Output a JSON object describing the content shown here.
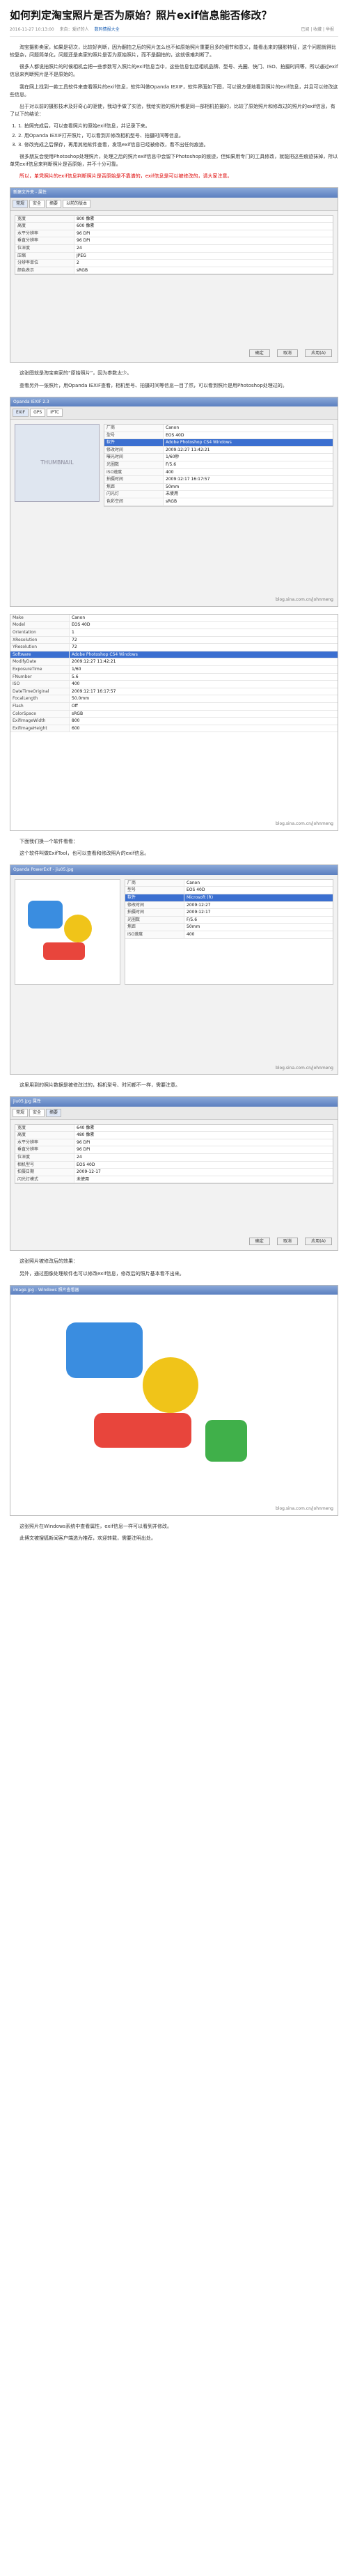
{
  "title": "如何判定淘宝照片是否为原始？照片exif信息能否修改？",
  "meta": {
    "date": "2016-11-27 10:13:00",
    "source": "来自：爱好的人",
    "category": "数码情报大全",
    "share": "已阅 | 收藏 | 举报"
  },
  "paras": [
    "淘宝摄影卖家，如果是初次，比较好判断，因为翻拍之后的照片怎么也不如原始照片重要且多的细节和意义，能看出来的摄影特征，这个问题就得比较复杂，问题简单化，问题还是卖家的照片是否为原始照片，而不是翻拍的，这就很难判断了。",
    "很多人都说拍照片的时候相机会把一些参数写入照片的exif信息当中，这些信息包括相机品牌、型号、光圈、快门、ISO、拍摄时间等，所以通过exif信息来判断照片是不是原始的。",
    "我在网上找到一款工具软件来查看照片的exif信息，软件叫做Opanda IEXIF，软件界面如下图，可以很方便地看到照片的exif信息，并且可以修改这些信息。",
    "出于对以前的摄影技术及好奇心的驱使，我动手做了实验，我给实验的照片都是同一部相机拍摄的，比较了原始照片和修改过的照片的exif信息，有了以下的结论：",
    "很多朋友会使用Photoshop处理照片，处理之后的照片exif信息中会留下Photoshop的痕迹，但如果用专门的工具修改，就能把这些痕迹抹掉，所以单凭exif信息来判断照片是否原始，并不十分可靠。"
  ],
  "list": [
    "1. 拍照完成后，可以查看照片的原始exif信息，并记录下来。",
    "2. 用Opanda IEXIF打开照片，可以看到并修改相机型号、拍摄时间等信息。",
    "3. 修改完成之后保存，再用其他软件查看，发现exif信息已经被修改，看不出任何痕迹。"
  ],
  "red_note": "所以，单凭照片的exif信息判断照片是否原始是不靠谱的，exif信息是可以被修改的，请大家注意。",
  "captions": {
    "c1": "这张图就是淘宝卖家的“原始照片”，因为参数太少。",
    "c2": "查看另外一张照片，用Opanda IEXIF查看，相机型号、拍摄时间等信息一目了然，可以看到照片是用Photoshop处理过的。",
    "c3": "下面我们换一个软件看看：",
    "c4": "这个软件叫做ExifTool，也可以查看和修改照片的exif信息。",
    "c5": "这里用到的照片数据是被修改过的，相机型号、时间都不一样，需要注意。",
    "c6": "这张照片被修改后的效果：",
    "c7": "另外，通过图像处理软件也可以修改exif信息，修改后的照片基本看不出来。",
    "c8": "这张照片在Windows系统中查看属性，exif信息一样可以看到并修改。",
    "c9": "此博文被搜狐新闻客户端选为推荐，欢迎转载，需要注明出处。"
  },
  "shot1": {
    "window": "新建文件夹 - 属性",
    "tabs": [
      "常规",
      "安全",
      "摘要",
      "以前的版本"
    ],
    "rows": [
      [
        "宽度",
        "800 像素"
      ],
      [
        "高度",
        "600 像素"
      ],
      [
        "水平分辨率",
        "96 DPI"
      ],
      [
        "垂直分辨率",
        "96 DPI"
      ],
      [
        "位深度",
        "24"
      ],
      [
        "压缩",
        "JPEG"
      ],
      [
        "分辨率单位",
        "2"
      ],
      [
        "颜色表示",
        "sRGB"
      ]
    ],
    "buttons": [
      "确定",
      "取消",
      "应用(A)"
    ]
  },
  "shot2": {
    "window": "Opanda IEXIF 2.3",
    "tabs": [
      "EXIF",
      "GPS",
      "IPTC"
    ],
    "thumb": "THUMBNAIL",
    "rows": [
      [
        "厂商",
        "Canon"
      ],
      [
        "型号",
        "EOS 40D"
      ],
      [
        "软件",
        "Adobe Photoshop CS4 Windows"
      ],
      [
        "修改时间",
        "2009:12:27 11:42:21"
      ],
      [
        "曝光时间",
        "1/60秒"
      ],
      [
        "光圈数",
        "F/5.6"
      ],
      [
        "ISO速度",
        "400"
      ],
      [
        "拍摄时间",
        "2009:12:17 16:17:57"
      ],
      [
        "焦距",
        "50mm"
      ],
      [
        "闪光灯",
        "未使用"
      ],
      [
        "色彩空间",
        "sRGB"
      ]
    ],
    "watermark": "blog.sina.com.cn/johnmeng"
  },
  "shot3": {
    "rows": [
      [
        "Make",
        "Canon"
      ],
      [
        "Model",
        "EOS 40D"
      ],
      [
        "Orientation",
        "1"
      ],
      [
        "XResolution",
        "72"
      ],
      [
        "YResolution",
        "72"
      ],
      [
        "Software",
        "Adobe Photoshop CS4 Windows"
      ],
      [
        "ModifyDate",
        "2009:12:27 11:42:21"
      ],
      [
        "ExposureTime",
        "1/60"
      ],
      [
        "FNumber",
        "5.6"
      ],
      [
        "ISO",
        "400"
      ],
      [
        "DateTimeOriginal",
        "2009:12:17 16:17:57"
      ],
      [
        "FocalLength",
        "50.0mm"
      ],
      [
        "Flash",
        "Off"
      ],
      [
        "ColorSpace",
        "sRGB"
      ],
      [
        "ExifImageWidth",
        "800"
      ],
      [
        "ExifImageHeight",
        "600"
      ]
    ],
    "watermark": "blog.sina.com.cn/johnmeng"
  },
  "shot4": {
    "window": "Opanda PowerExif - jiu05.jpg",
    "rows": [
      [
        "厂商",
        "Canon"
      ],
      [
        "型号",
        "EOS 40D"
      ],
      [
        "软件",
        "Microsoft (R)"
      ],
      [
        "修改时间",
        "2009:12:27"
      ],
      [
        "拍摄时间",
        "2009:12:17"
      ],
      [
        "光圈数",
        "F/5.6"
      ],
      [
        "焦距",
        "50mm"
      ],
      [
        "ISO速度",
        "400"
      ]
    ],
    "watermark": "blog.sina.com.cn/johnmeng"
  },
  "shot5": {
    "window": "jiu05.jpg 属性",
    "tabs": [
      "常规",
      "安全",
      "摘要"
    ],
    "rows": [
      [
        "宽度",
        "640 像素"
      ],
      [
        "高度",
        "480 像素"
      ],
      [
        "水平分辨率",
        "96 DPI"
      ],
      [
        "垂直分辨率",
        "96 DPI"
      ],
      [
        "位深度",
        "24"
      ],
      [
        "相机型号",
        "EOS 40D"
      ],
      [
        "拍摄日期",
        "2009-12-17"
      ],
      [
        "闪光灯模式",
        "未使用"
      ]
    ],
    "buttons": [
      "确定",
      "取消",
      "应用(A)"
    ]
  },
  "shot6": {
    "window": "image.jpg - Windows 照片查看器",
    "watermark": "blog.sina.com.cn/johnmeng"
  }
}
